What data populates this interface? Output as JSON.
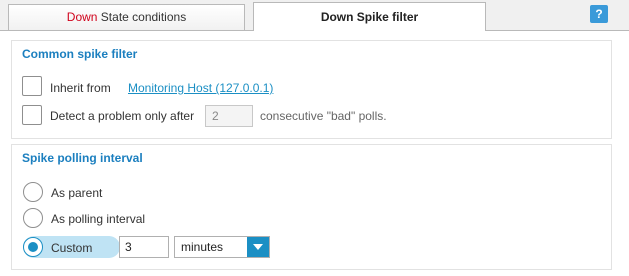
{
  "tabs": {
    "tab1_prefix": "Down",
    "tab1_suffix": " State conditions",
    "tab2_label": "Down Spike filter",
    "help_label": "?"
  },
  "common": {
    "title": "Common spike filter",
    "inherit_label": "Inherit from",
    "inherit_link": "Monitoring Host (127.0.0.1)",
    "detect_label": "Detect a problem only after",
    "polls_value": "2",
    "polls_suffix": "consecutive \"bad\" polls."
  },
  "interval": {
    "title": "Spike polling interval",
    "options": [
      "As parent",
      "As polling interval",
      "Custom"
    ],
    "selected": "Custom",
    "custom_value": "3",
    "unit": "minutes"
  },
  "colors": {
    "accent": "#1b8fc4",
    "title": "#1b7fbf",
    "warning_red": "#d0021b"
  }
}
